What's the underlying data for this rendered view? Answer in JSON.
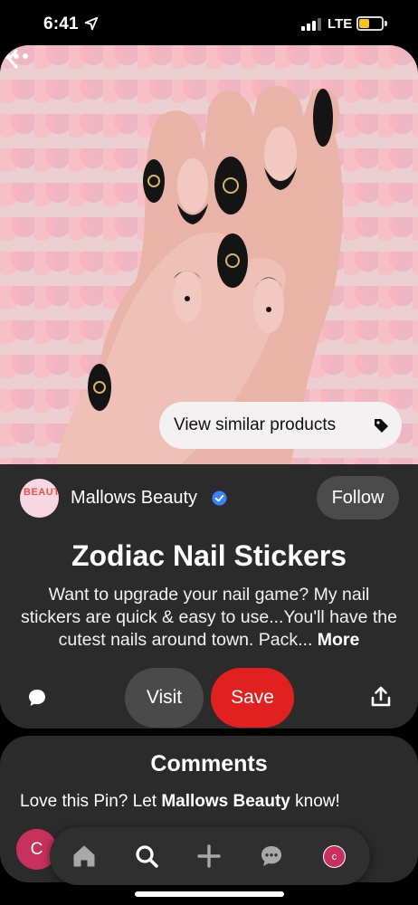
{
  "status_bar": {
    "time": "6:41",
    "network": "LTE",
    "battery_color": "#f5c518",
    "icons": [
      "location-arrow-icon",
      "signal-icon",
      "battery-icon"
    ]
  },
  "pin": {
    "image_alt": "Zodiac nail stickers on black and pink nails",
    "actions": {
      "back_icon": "chevron-left-icon",
      "more_icon": "more-dots-icon",
      "view_similar_label": "View similar products",
      "view_similar_icon": "tag-icon"
    },
    "creator": {
      "name": "Mallows Beauty",
      "avatar_text": "BEAUTY",
      "verified_icon": "verified-badge-icon",
      "follow_label": "Follow"
    },
    "title": "Zodiac Nail Stickers",
    "description": "Want to upgrade your nail game? My nail stickers are quick & easy to use...You'll have the cutest nails around town. Pack...",
    "more_label": "More",
    "buttons": {
      "comment_icon": "comment-icon",
      "visit_label": "Visit",
      "save_label": "Save",
      "share_icon": "share-icon"
    }
  },
  "comments": {
    "title": "Comments",
    "prompt_prefix": "Love this Pin? Let ",
    "prompt_name": "Mallows Beauty",
    "prompt_suffix": " know!",
    "user_initial": "C"
  },
  "bottom_nav": {
    "items": [
      "home-icon",
      "search-icon",
      "plus-icon",
      "messages-icon",
      "profile-avatar"
    ],
    "profile_initial": "c"
  },
  "colors": {
    "card_bg": "#2b2b2b",
    "save_red": "#e0211f",
    "avatar_pink": "#c8305e",
    "verified_blue": "#3b82f6"
  }
}
